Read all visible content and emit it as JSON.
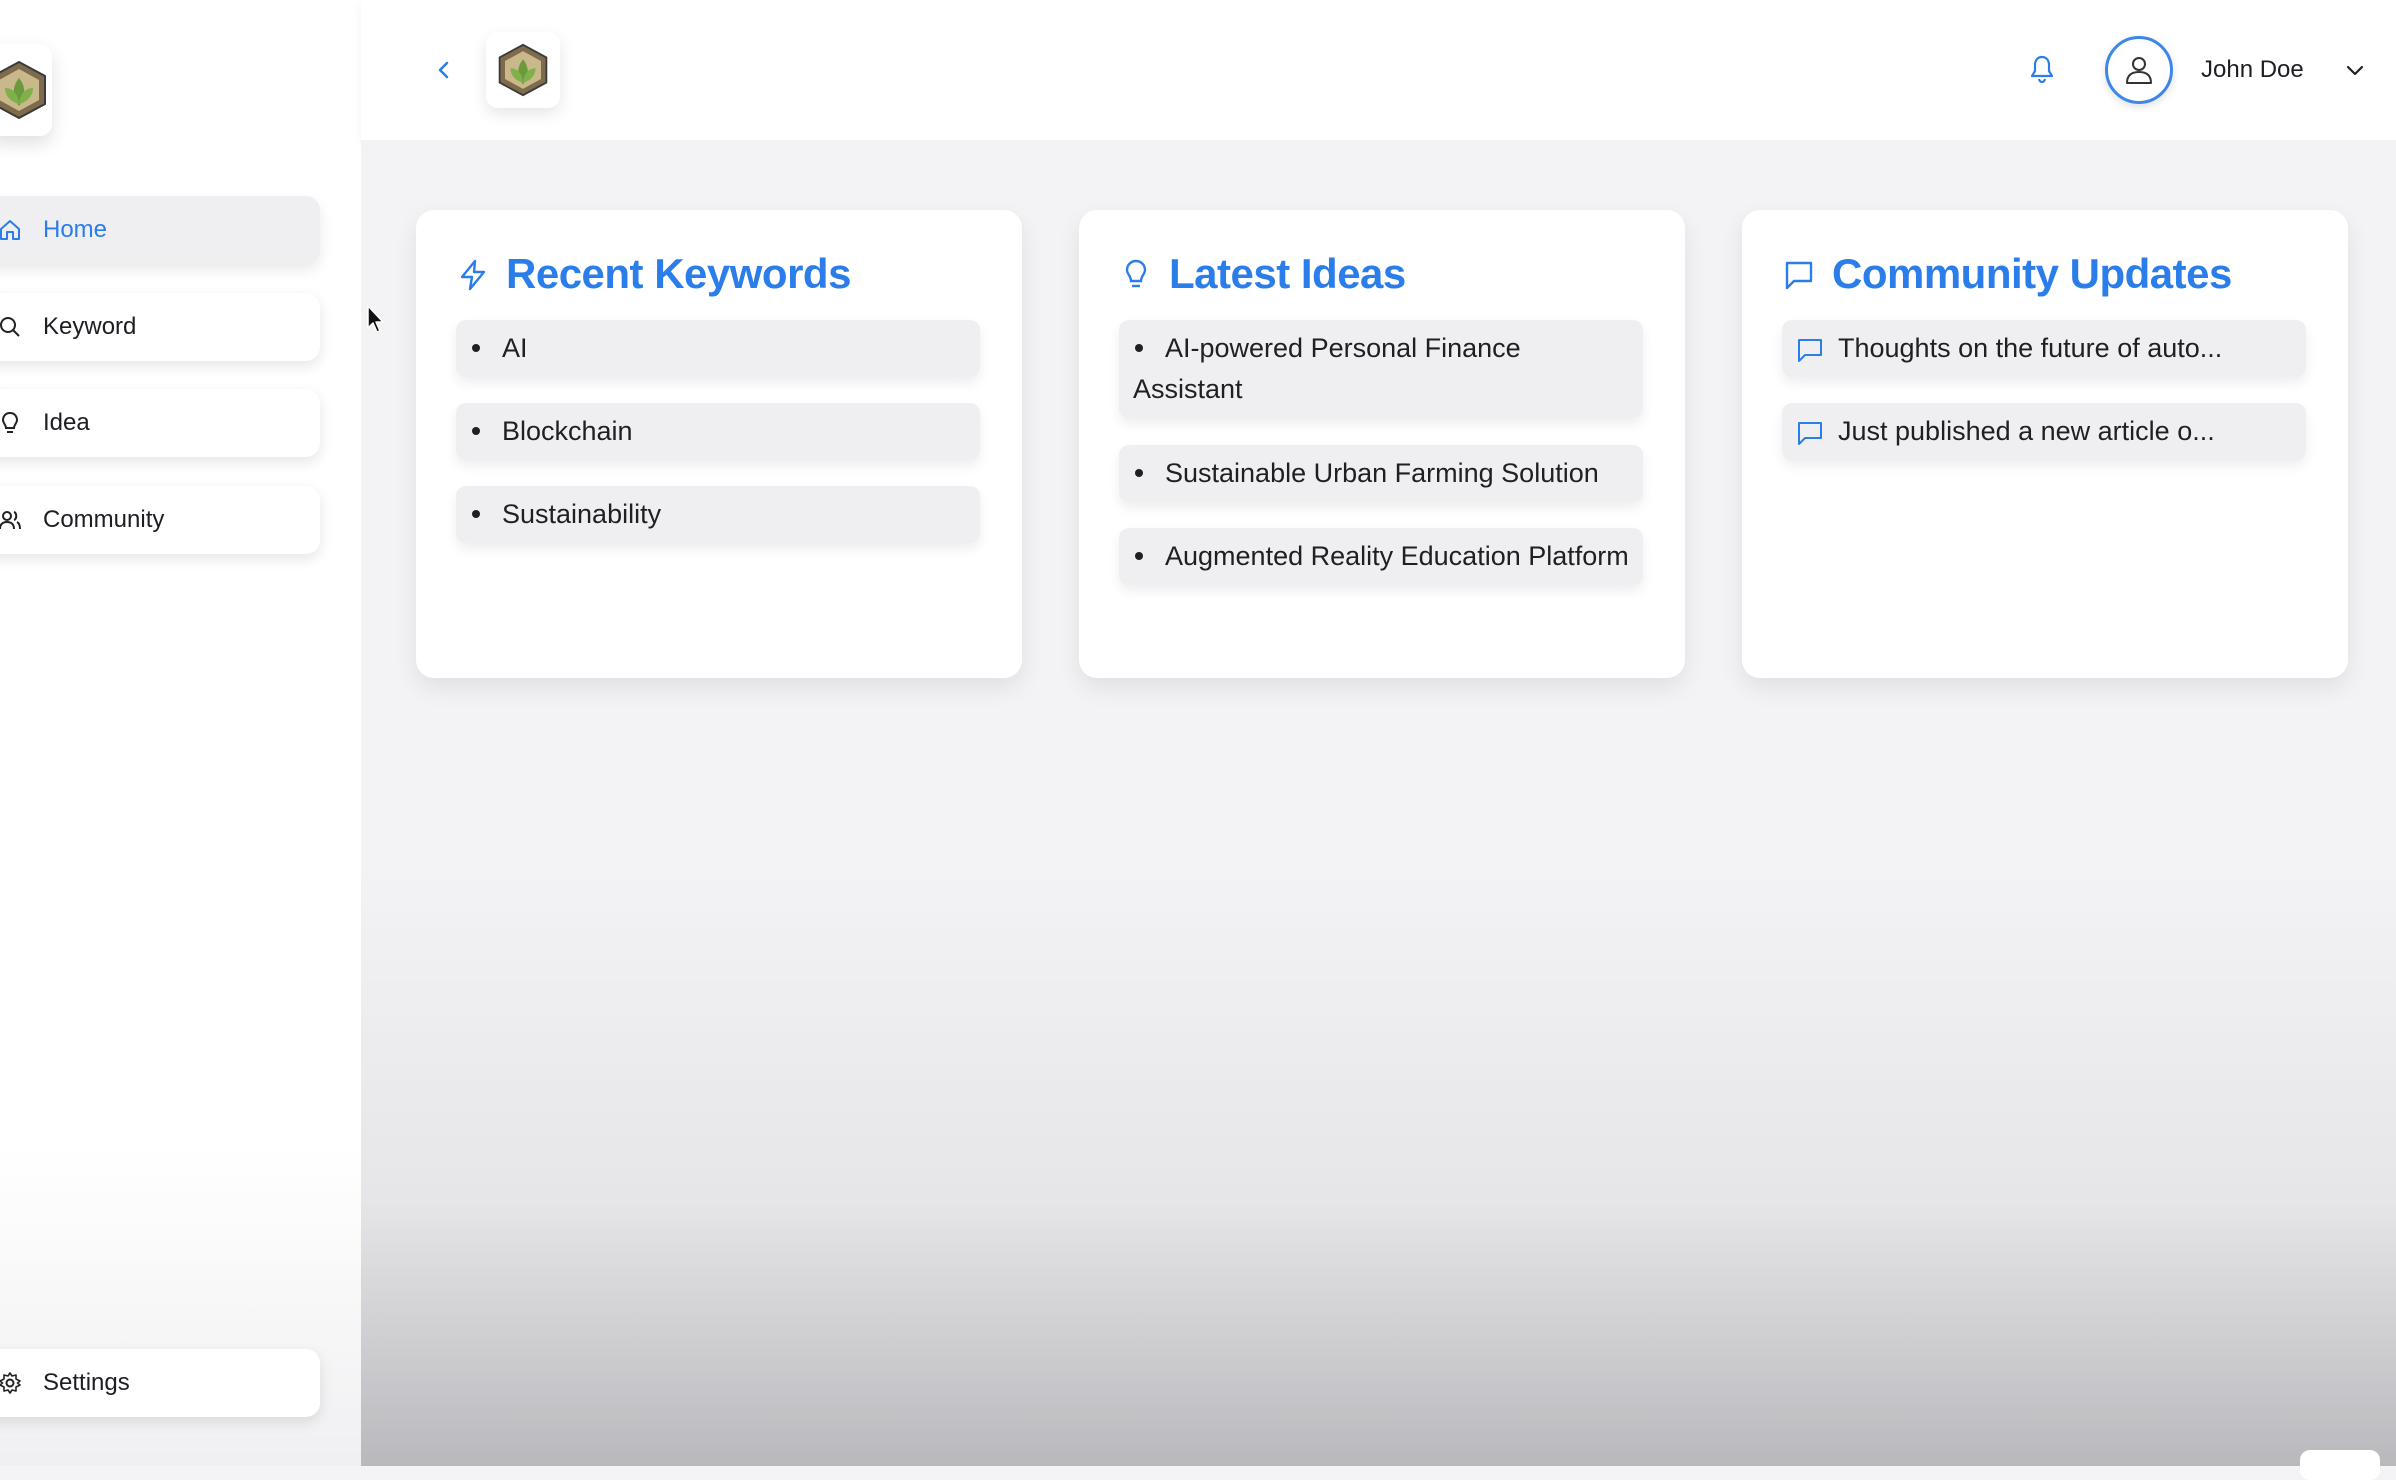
{
  "sidebar": {
    "items": [
      {
        "label": "Home",
        "icon": "home-icon",
        "active": true
      },
      {
        "label": "Keyword",
        "icon": "search-icon",
        "active": false
      },
      {
        "label": "Idea",
        "icon": "lightbulb-icon",
        "active": false
      },
      {
        "label": "Community",
        "icon": "users-icon",
        "active": false
      }
    ],
    "settings_label": "Settings"
  },
  "header": {
    "user_name": "John Doe"
  },
  "cards": {
    "keywords": {
      "title": "Recent Keywords",
      "items": [
        "AI",
        "Blockchain",
        "Sustainability"
      ]
    },
    "ideas": {
      "title": "Latest Ideas",
      "items": [
        "AI-powered Personal Finance Assistant",
        "Sustainable Urban Farming Solution",
        "Augmented Reality Education Platform"
      ]
    },
    "community": {
      "title": "Community Updates",
      "items": [
        "Thoughts on the future of auto...",
        "Just published a new article o..."
      ]
    }
  },
  "colors": {
    "accent": "#2b7de9",
    "logo_hex": "#8b7a5a",
    "logo_leaf": "#6a9a3c"
  }
}
